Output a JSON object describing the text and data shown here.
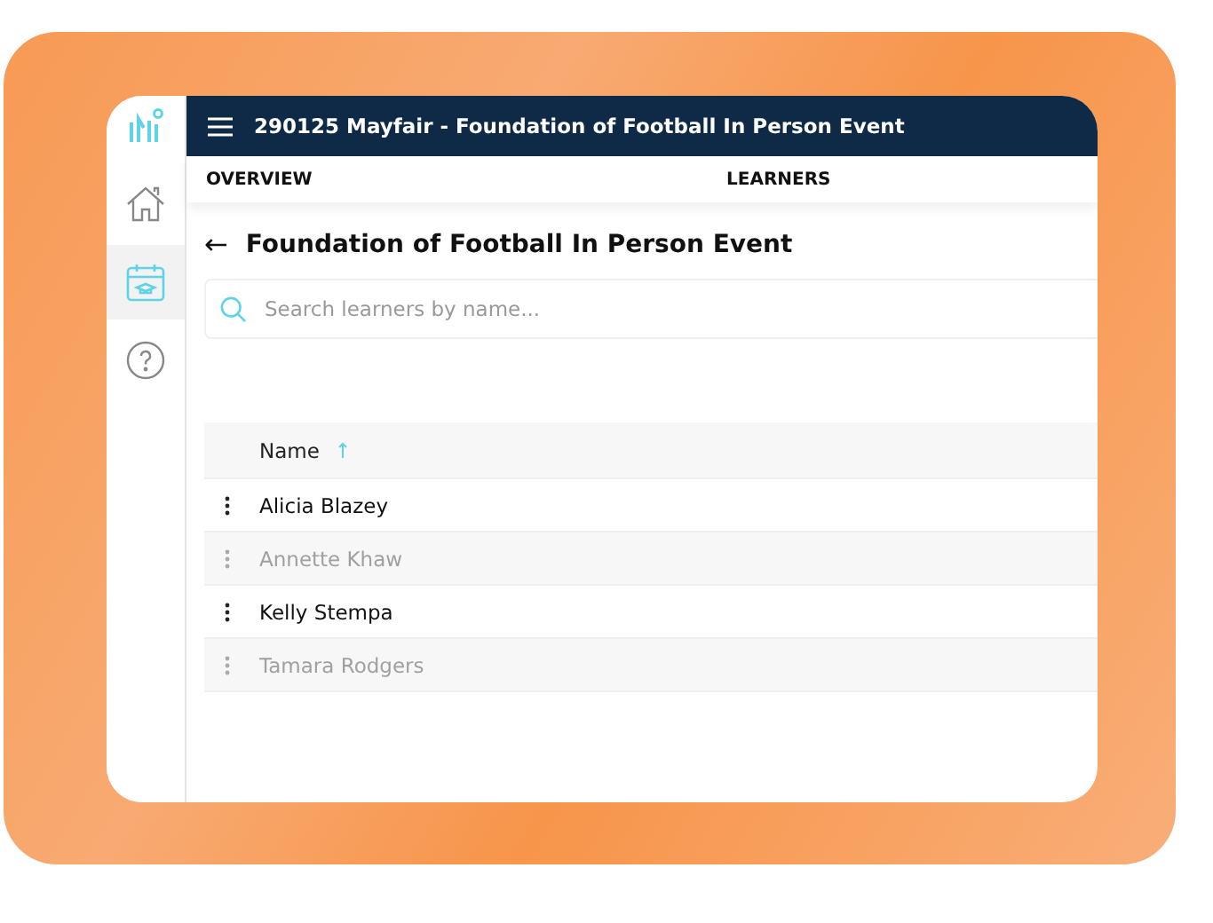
{
  "sidebar": {
    "items": [
      {
        "kind": "home",
        "selected": false
      },
      {
        "kind": "calendar",
        "selected": true
      },
      {
        "kind": "help",
        "selected": false
      }
    ]
  },
  "header": {
    "title": "290125 Mayfair - Foundation of Football In Person Event"
  },
  "tabs": [
    {
      "label": "OVERVIEW"
    },
    {
      "label": "LEARNERS"
    }
  ],
  "page": {
    "back": "←",
    "title": "Foundation of Football In Person Event"
  },
  "search": {
    "placeholder": "Search learners by name..."
  },
  "table": {
    "columns": [
      {
        "label": "Name",
        "sorted": true
      }
    ],
    "rows": [
      {
        "name": "Alicia Blazey",
        "disabled": false
      },
      {
        "name": "Annette Khaw",
        "disabled": true
      },
      {
        "name": "Kelly Stempa",
        "disabled": false
      },
      {
        "name": "Tamara Rodgers",
        "disabled": true
      }
    ]
  }
}
